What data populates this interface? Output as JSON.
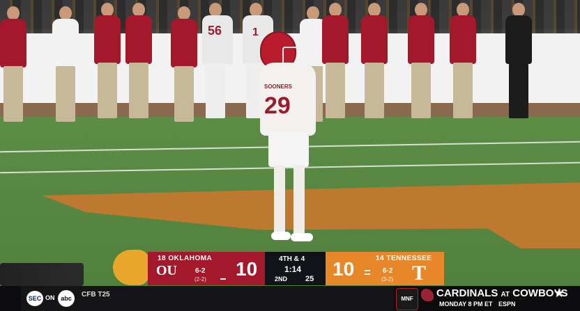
{
  "scorebug": {
    "away": {
      "rank_name": "18 OKLAHOMA",
      "logo_text": "OU",
      "record": "6-2",
      "conf_record": "(2-2)",
      "score": "10",
      "color": "#a3182a"
    },
    "home": {
      "rank_name": "14 TENNESSEE",
      "logo_text": "T",
      "record": "6-2",
      "conf_record": "(3-2)",
      "score": "10",
      "color": "#e8872a"
    },
    "down_distance": "4TH & 4",
    "clock": "1:14",
    "quarter": "2ND",
    "play_clock": "25"
  },
  "ticker": {
    "sec_label": "SEC",
    "on_label": "ON",
    "network": "abc",
    "headline": "CFB T25",
    "promo_logo": "MNF",
    "promo_away": "CARDINALS",
    "promo_at": "AT",
    "promo_home": "COWBOYS",
    "promo_time": "MONDAY 8 PM ET",
    "promo_network": "ESPN"
  },
  "player": {
    "number": "29",
    "jersey_text": "SOONERS"
  },
  "sideline": {
    "number_a": "56",
    "number_b": "1"
  },
  "icons": [
    "football-icon",
    "ou-logo-icon",
    "t-logo-icon",
    "sec-logo-icon",
    "abc-logo-icon",
    "mnf-logo-icon",
    "cardinals-icon",
    "star-icon"
  ]
}
